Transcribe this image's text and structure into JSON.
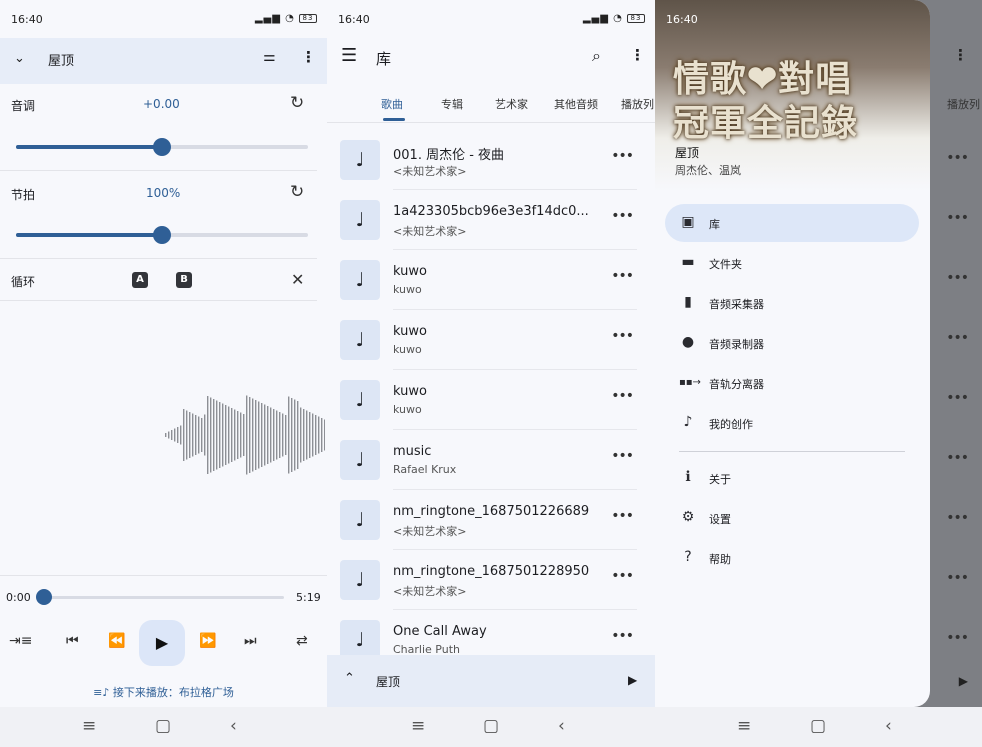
{
  "status": {
    "time": "16:40",
    "signal": "5ᵍᵢₗ.ıll",
    "battery": "83"
  },
  "p1": {
    "toolbar": {
      "title": "屋顶"
    },
    "pitch": {
      "label": "音调",
      "value": "+0.00",
      "fraction": 0.48
    },
    "tempo": {
      "label": "节拍",
      "value": "100%",
      "fraction": 0.48
    },
    "loop": {
      "label": "循环",
      "a": "A",
      "b": "B"
    },
    "progress": {
      "elapsed": "0:00",
      "total": "5:19",
      "fraction": 0.0
    },
    "up_next": "接下来播放：布拉格广场"
  },
  "p2": {
    "toolbar": {
      "title": "库"
    },
    "tabs": [
      "歌曲",
      "专辑",
      "艺术家",
      "其他音频",
      "播放列"
    ],
    "songs": [
      {
        "title": "001. 周杰伦 - 夜曲",
        "sub": "<未知艺术家>"
      },
      {
        "title": "1a423305bcb96e3e3f14dc0...",
        "sub": "<未知艺术家>"
      },
      {
        "title": "kuwo",
        "sub": "kuwo"
      },
      {
        "title": "kuwo",
        "sub": "kuwo"
      },
      {
        "title": "kuwo",
        "sub": "kuwo"
      },
      {
        "title": "music",
        "sub": "Rafael Krux"
      },
      {
        "title": "nm_ringtone_1687501226689",
        "sub": "<未知艺术家>"
      },
      {
        "title": "nm_ringtone_1687501228950",
        "sub": "<未知艺术家>"
      },
      {
        "title": "One Call Away",
        "sub": "Charlie Puth"
      }
    ],
    "mini": {
      "title": "屋顶"
    }
  },
  "p3": {
    "cover": {
      "line1": "情歌❤對唱",
      "line2": "冠軍全記錄",
      "caption": "..."
    },
    "now": {
      "title": "屋顶",
      "artist": "周杰伦、温岚"
    },
    "items": [
      {
        "icon": "library-icon",
        "glyph": "▣",
        "label": "库",
        "active": true
      },
      {
        "icon": "folder-icon",
        "glyph": "▬",
        "label": "文件夹"
      },
      {
        "icon": "file-icon",
        "glyph": "▮",
        "label": "音频采集器"
      },
      {
        "icon": "disc-icon",
        "glyph": "●",
        "label": "音频录制器"
      },
      {
        "icon": "track-split-icon",
        "glyph": "▪▪→",
        "label": "音轨分离器"
      },
      {
        "icon": "user-music-icon",
        "glyph": "♪",
        "label": "我的创作"
      }
    ],
    "items2": [
      {
        "icon": "info-icon",
        "glyph": "ℹ",
        "label": "关于"
      },
      {
        "icon": "gear-icon",
        "glyph": "⚙",
        "label": "设置"
      },
      {
        "icon": "help-icon",
        "glyph": "?",
        "label": "帮助"
      }
    ],
    "behind_tab": "播放列"
  }
}
